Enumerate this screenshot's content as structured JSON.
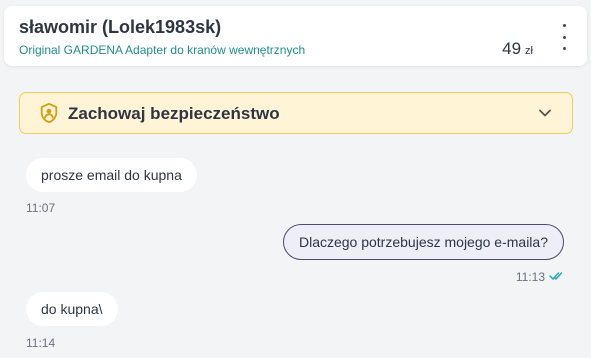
{
  "header": {
    "user_name": "sławomir (Lolek1983sk)",
    "listing_title": "Original GARDENA Adapter do kranów wewnętrznych",
    "price_value": "49",
    "price_currency": "zł"
  },
  "banner": {
    "label": "Zachowaj bezpieczeństwo",
    "icon": "shield-user-icon",
    "expand_icon": "chevron-down-icon"
  },
  "messages": [
    {
      "direction": "incoming",
      "text": "prosze email do kupna",
      "time": "11:07"
    },
    {
      "direction": "outgoing",
      "text": "Dlaczego potrzebujesz mojego e-maila?",
      "time": "11:13",
      "status": "read"
    },
    {
      "direction": "incoming",
      "text": "do kupna\\",
      "time": "11:14"
    }
  ],
  "colors": {
    "accent_teal": "#1f8e8e",
    "banner_bg": "#fff5d6",
    "banner_border": "#f1cc5c",
    "read_check": "#2aa6b4"
  }
}
